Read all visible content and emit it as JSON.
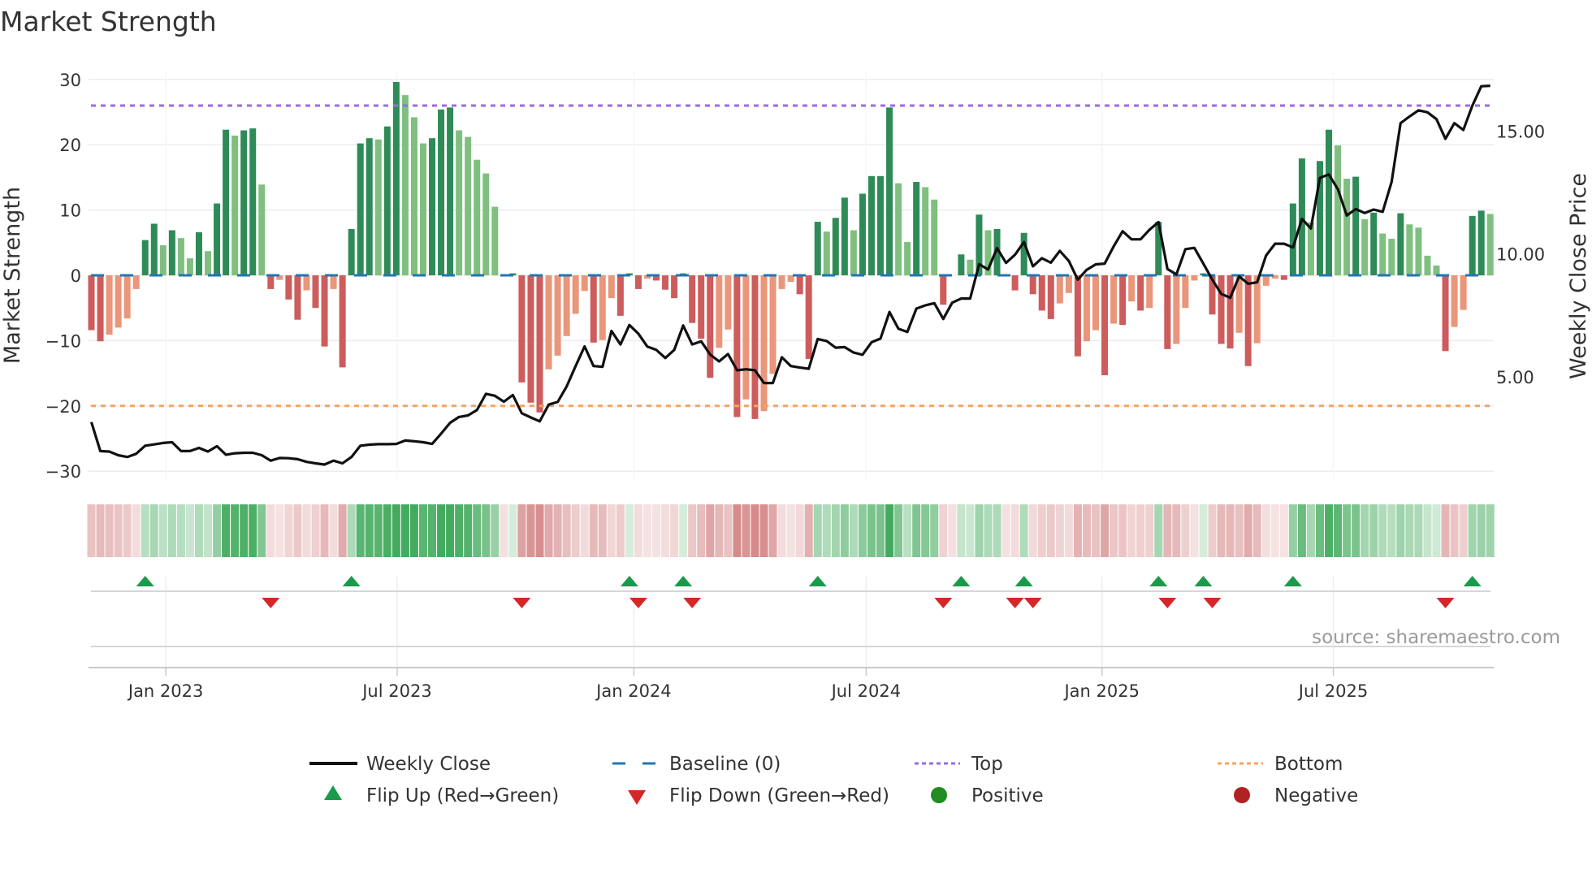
{
  "chart_data": {
    "type": "bar",
    "title": "Market Strength",
    "ylabel": "Market Strength",
    "y2label": "Weekly Close Price",
    "ylim": [
      -32,
      32
    ],
    "y_ticks": [
      30,
      20,
      10,
      0,
      -10,
      -20,
      -30
    ],
    "y_tick_labels": [
      "30",
      "20",
      "10",
      "0",
      "−10",
      "−20",
      "−30"
    ],
    "y2_ticks": [
      15,
      10,
      5
    ],
    "y2_tick_labels": [
      "15.00",
      "10.00",
      "5.00"
    ],
    "x_ticks": [
      {
        "week_index": 8.3,
        "label": "Jan 2023"
      },
      {
        "week_index": 34.1,
        "label": "Jul 2023"
      },
      {
        "week_index": 60.5,
        "label": "Jan 2024"
      },
      {
        "week_index": 86.4,
        "label": "Jul 2024"
      },
      {
        "week_index": 112.7,
        "label": "Jan 2025"
      },
      {
        "week_index": 138.5,
        "label": "Jul 2025"
      }
    ],
    "top_level": 26,
    "bottom_level": -20,
    "baseline": 0,
    "strength": [
      -8.4,
      -10.1,
      -9.1,
      -8.0,
      -6.6,
      -2.1,
      5.4,
      7.9,
      4.6,
      6.9,
      5.7,
      2.6,
      6.6,
      3.7,
      11.0,
      22.3,
      21.4,
      22.2,
      22.5,
      13.9,
      -2.1,
      -0.7,
      -3.7,
      -6.8,
      -2.3,
      -5.0,
      -10.9,
      -2.1,
      -14.1,
      7.1,
      20.2,
      21.0,
      20.8,
      22.8,
      29.6,
      27.6,
      24.2,
      20.2,
      21.0,
      25.4,
      25.7,
      22.2,
      21.2,
      17.7,
      15.6,
      10.5,
      0,
      0.3,
      -16.4,
      -19.5,
      -21.0,
      -14.4,
      -12.3,
      -9.3,
      -5.9,
      -2.4,
      -10.3,
      -9.9,
      -3.5,
      -6.2,
      0.3,
      -2.1,
      -0.5,
      -0.8,
      -2.2,
      -3.5,
      0.3,
      -7.3,
      -9.7,
      -15.7,
      -11.1,
      -8.3,
      -21.7,
      -19.0,
      -22.0,
      -20.8,
      -15.1,
      -2.1,
      -1.0,
      -2.9,
      -12.8,
      8.2,
      6.7,
      8.8,
      11.9,
      6.9,
      12.5,
      15.2,
      15.2,
      25.7,
      14.1,
      5.1,
      14.3,
      13.5,
      11.6,
      -4.5,
      0,
      3.2,
      2.4,
      9.3,
      6.9,
      7.1,
      0,
      -2.3,
      6.5,
      -2.9,
      -5.4,
      -6.7,
      -4.3,
      -2.7,
      -12.4,
      -10.1,
      -8.4,
      -15.3,
      -7.4,
      -7.6,
      -4.0,
      -5.4,
      -5.0,
      8.2,
      -11.3,
      -10.5,
      -5.0,
      -0.8,
      0.3,
      -6.0,
      -10.5,
      -11.2,
      -8.8,
      -13.9,
      -10.4,
      -1.6,
      -0.5,
      -0.7,
      11.0,
      17.9,
      8.1,
      17.5,
      22.3,
      19.9,
      14.8,
      15.1,
      8.6,
      9.6,
      6.4,
      5.6,
      9.5,
      7.8,
      7.3,
      3.0,
      1.5,
      -11.6,
      -7.9,
      -5.3,
      9.1,
      9.9,
      9.4
    ],
    "weekly_close": [
      3.15,
      1.97,
      1.95,
      1.8,
      1.73,
      1.86,
      2.19,
      2.24,
      2.3,
      2.33,
      1.97,
      1.97,
      2.1,
      1.95,
      2.17,
      1.82,
      1.88,
      1.9,
      1.9,
      1.8,
      1.58,
      1.69,
      1.68,
      1.64,
      1.53,
      1.47,
      1.42,
      1.58,
      1.47,
      1.73,
      2.19,
      2.23,
      2.25,
      2.25,
      2.26,
      2.4,
      2.37,
      2.33,
      2.26,
      2.68,
      3.12,
      3.36,
      3.42,
      3.64,
      4.3,
      4.22,
      3.98,
      4.25,
      3.51,
      3.34,
      3.18,
      3.86,
      3.97,
      4.6,
      5.43,
      6.23,
      5.43,
      5.4,
      6.86,
      6.31,
      7.1,
      6.75,
      6.22,
      6.09,
      5.76,
      6.09,
      7.08,
      6.31,
      6.44,
      5.9,
      5.62,
      5.92,
      5.26,
      5.3,
      5.26,
      4.74,
      4.74,
      5.79,
      5.43,
      5.37,
      5.32,
      6.53,
      6.45,
      6.18,
      6.2,
      5.98,
      5.89,
      6.4,
      6.55,
      7.63,
      6.95,
      6.82,
      7.77,
      7.9,
      7.99,
      7.35,
      8.01,
      8.18,
      8.18,
      9.58,
      9.36,
      10.23,
      9.63,
      9.96,
      10.48,
      9.49,
      9.82,
      9.64,
      10.12,
      9.71,
      8.95,
      9.35,
      9.57,
      9.6,
      10.3,
      10.92,
      10.59,
      10.59,
      10.98,
      11.29,
      9.38,
      9.16,
      10.19,
      10.24,
      9.6,
      8.95,
      8.37,
      8.21,
      9.08,
      8.78,
      8.84,
      9.93,
      10.41,
      10.41,
      10.26,
      11.42,
      11.03,
      13.09,
      13.23,
      12.63,
      11.56,
      11.82,
      11.66,
      11.8,
      11.71,
      12.93,
      15.32,
      15.59,
      15.84,
      15.76,
      15.48,
      14.68,
      15.32,
      15.04,
      16.03,
      16.82,
      16.84
    ],
    "flip_up_weeks": [
      6,
      29,
      60,
      66,
      81,
      97,
      104,
      119,
      124,
      134,
      154
    ],
    "flip_down_weeks": [
      20,
      48,
      61,
      67,
      95,
      103,
      105,
      120,
      125,
      151
    ],
    "legend": {
      "weekly_close": "Weekly Close",
      "baseline": "Baseline (0)",
      "top": "Top",
      "bottom": "Bottom",
      "flip_up": "Flip Up (Red→Green)",
      "flip_down": "Flip Down (Green→Red)",
      "positive": "Positive",
      "negative": "Negative"
    },
    "legend_placement": "bottom",
    "grid": true
  },
  "source": "source: sharemaestro.com",
  "colors": {
    "pos_strong": "#2e8b57",
    "pos_weak": "#7fbf7f",
    "neg_strong": "#cd5c5c",
    "neg_weak": "#e9967a",
    "top": "#9b6be0",
    "bottom": "#f4a460",
    "baseline": "#1f77b4",
    "up": "#1a9a4a",
    "down": "#d62728",
    "positive": "#228b22",
    "negative": "#b22222"
  }
}
